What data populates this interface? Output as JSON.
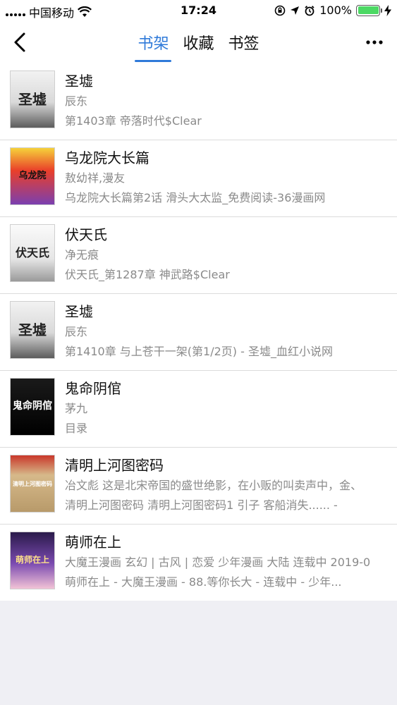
{
  "status_bar": {
    "carrier": "中国移动",
    "time": "17:24",
    "battery": "100%",
    "battery_level": 1.0
  },
  "nav": {
    "tabs": [
      {
        "label": "书架",
        "active": true
      },
      {
        "label": "收藏",
        "active": false
      },
      {
        "label": "书签",
        "active": false
      }
    ],
    "more_label": "•••"
  },
  "books": [
    {
      "title": "圣墟",
      "author": "辰东",
      "chapter": "第1403章 帝落时代$Clear",
      "cover_text": "圣墟"
    },
    {
      "title": "乌龙院大长篇",
      "author": " 敖幼祥,漫友",
      "chapter": "乌龙院大长篇第2话 滑头大太监_免费阅读-36漫画网",
      "cover_text": "乌龙院"
    },
    {
      "title": "伏天氏",
      "author": "净无痕",
      "chapter": "伏天氏_第1287章 神武路$Clear",
      "cover_text": "伏天氏"
    },
    {
      "title": "圣墟",
      "author": "辰东",
      "chapter": "第1410章 与上苍干一架(第1/2页) - 圣墟_血红小说网",
      "cover_text": "圣墟"
    },
    {
      "title": "鬼命阴倌",
      "author": "茅九",
      "chapter": "目录",
      "cover_text": "鬼命阴倌"
    },
    {
      "title": "清明上河图密码",
      "author": "冶文彪 这是北宋帝国的盛世绝影，在小贩的叫卖声中，金、",
      "chapter": "清明上河图密码 清明上河图密码1 引子 客船消失...... -",
      "cover_text": "清明上河图密码"
    },
    {
      "title": "萌师在上",
      "author": "大魔王漫画 玄幻 | 古风 | 恋爱 少年漫画 大陆 连载中 2019-0",
      "chapter": "萌师在上 - 大魔王漫画 - 88.等你长大 - 连载中 - 少年...",
      "cover_text": "萌师在上"
    }
  ]
}
